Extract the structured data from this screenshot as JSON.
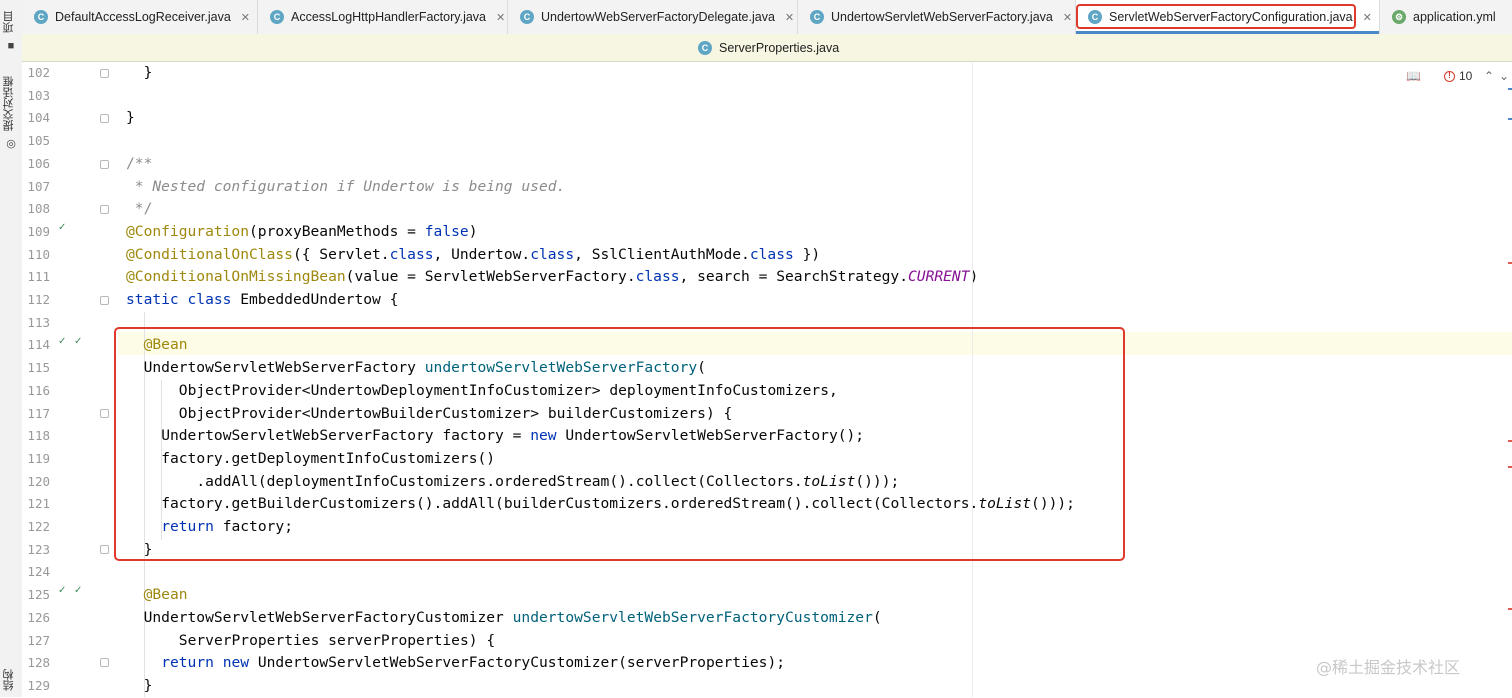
{
  "left_strip": {
    "project_label": "项目",
    "commit_label": "提交对话框",
    "structure_label": "结构"
  },
  "tabs": [
    {
      "label": "DefaultAccessLogReceiver.java",
      "icon": "java-class-icon"
    },
    {
      "label": "AccessLogHttpHandlerFactory.java",
      "icon": "java-class-icon"
    },
    {
      "label": "UndertowWebServerFactoryDelegate.java",
      "icon": "java-class-icon"
    },
    {
      "label": "UndertowServletWebServerFactory.java",
      "icon": "java-class-icon"
    },
    {
      "label": "ServletWebServerFactoryConfiguration.java",
      "icon": "java-class-icon",
      "active": true
    },
    {
      "label": "application.yml",
      "icon": "yaml-file-icon"
    }
  ],
  "tabs_row2": [
    {
      "label": "ServerProperties.java",
      "icon": "java-class-icon"
    }
  ],
  "inspection": {
    "error_count": "10",
    "icon": "reader-mode-icon"
  },
  "line_numbers": [
    "102",
    "103",
    "104",
    "105",
    "106",
    "107",
    "108",
    "109",
    "110",
    "111",
    "112",
    "113",
    "114",
    "115",
    "116",
    "117",
    "118",
    "119",
    "120",
    "121",
    "122",
    "123",
    "124",
    "125",
    "126",
    "127",
    "128",
    "129"
  ],
  "code": {
    "l102": {
      "a": "}"
    },
    "l103": {},
    "l104": {
      "a": "}"
    },
    "l105": {},
    "l106": {
      "a": "/**"
    },
    "l107": {
      "a": " * Nested configuration if Undertow is being used."
    },
    "l108": {
      "a": " */"
    },
    "l109": {
      "ann": "@Configuration",
      "a": "(proxyBeanMethods = ",
      "kw": "false",
      "b": ")"
    },
    "l110": {
      "ann": "@ConditionalOnClass",
      "a": "({ Servlet.",
      "kw1": "class",
      "b": ", Undertow.",
      "kw2": "class",
      "c": ", SslClientAuthMode.",
      "kw3": "class",
      "d": " })"
    },
    "l111": {
      "ann": "@ConditionalOnMissingBean",
      "a": "(value = ServletWebServerFactory.",
      "kw": "class",
      "b": ", search = SearchStrategy.",
      "st": "CURRENT",
      "c": ")"
    },
    "l112": {
      "kw": "static class",
      "a": " EmbeddedUndertow {"
    },
    "l113": {},
    "l114": {
      "ann": "@Bean"
    },
    "l115": {
      "a": "UndertowServletWebServerFactory ",
      "m": "undertowServletWebServerFactory",
      "b": "("
    },
    "l116": {
      "a": "ObjectProvider<UndertowDeploymentInfoCustomizer> deploymentInfoCustomizers,"
    },
    "l117": {
      "a": "ObjectProvider<UndertowBuilderCustomizer> builderCustomizers) {"
    },
    "l118": {
      "a": "UndertowServletWebServerFactory factory = ",
      "kw": "new",
      "b": " UndertowServletWebServerFactory();"
    },
    "l119": {
      "a": "factory.getDeploymentInfoCustomizers()"
    },
    "l120": {
      "a": ".addAll(deploymentInfoCustomizers.orderedStream().collect(Collectors.",
      "it": "toList",
      "b": "()));"
    },
    "l121": {
      "a": "factory.getBuilderCustomizers().addAll(builderCustomizers.orderedStream().collect(Collectors.",
      "it": "toList",
      "b": "()));"
    },
    "l122": {
      "kw": "return",
      "a": " factory;"
    },
    "l123": {
      "a": "}"
    },
    "l124": {},
    "l125": {
      "ann": "@Bean"
    },
    "l126": {
      "a": "UndertowServletWebServerFactoryCustomizer ",
      "m": "undertowServletWebServerFactoryCustomizer",
      "b": "("
    },
    "l127": {
      "a": "ServerProperties serverProperties) {"
    },
    "l128": {
      "kw": "return new",
      "a": " UndertowServletWebServerFactoryCustomizer(serverProperties);"
    },
    "l129": {
      "a": "}"
    }
  },
  "watermark": "@稀土掘金技术社区",
  "colors": {
    "keyword": "#0033b3",
    "annotation": "#9e880d",
    "comment": "#8c8c8c",
    "method": "#00627a",
    "static_field": "#871094",
    "highlight_box": "#e0392b",
    "active_tab_underline": "#4a88c7"
  }
}
